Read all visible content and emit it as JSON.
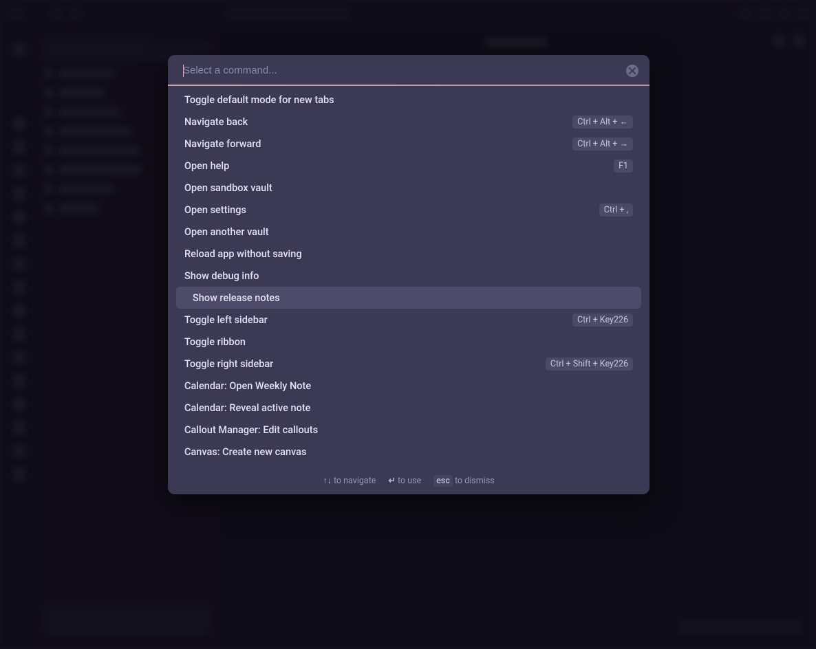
{
  "palette": {
    "placeholder": "Select a command...",
    "selectedIndex": 9,
    "items": [
      {
        "label": "Toggle default mode for new tabs",
        "hotkey": ""
      },
      {
        "label": "Navigate back",
        "hotkey": "Ctrl + Alt + ←"
      },
      {
        "label": "Navigate forward",
        "hotkey": "Ctrl + Alt + →"
      },
      {
        "label": "Open help",
        "hotkey": "F1"
      },
      {
        "label": "Open sandbox vault",
        "hotkey": ""
      },
      {
        "label": "Open settings",
        "hotkey": "Ctrl + ,"
      },
      {
        "label": "Open another vault",
        "hotkey": ""
      },
      {
        "label": "Reload app without saving",
        "hotkey": ""
      },
      {
        "label": "Show debug info",
        "hotkey": ""
      },
      {
        "label": "Show release notes",
        "hotkey": ""
      },
      {
        "label": "Toggle left sidebar",
        "hotkey": "Ctrl + Key226"
      },
      {
        "label": "Toggle ribbon",
        "hotkey": ""
      },
      {
        "label": "Toggle right sidebar",
        "hotkey": "Ctrl + Shift + Key226"
      },
      {
        "label": "Calendar: Open Weekly Note",
        "hotkey": ""
      },
      {
        "label": "Calendar: Reveal active note",
        "hotkey": ""
      },
      {
        "label": "Callout Manager: Edit callouts",
        "hotkey": ""
      },
      {
        "label": "Canvas: Create new canvas",
        "hotkey": ""
      }
    ],
    "instructions": {
      "navigate_keys": "↑↓",
      "navigate_text": "to navigate",
      "use_keys": "↵",
      "use_text": "to use",
      "dismiss_keys": "esc",
      "dismiss_text": "to dismiss"
    }
  }
}
